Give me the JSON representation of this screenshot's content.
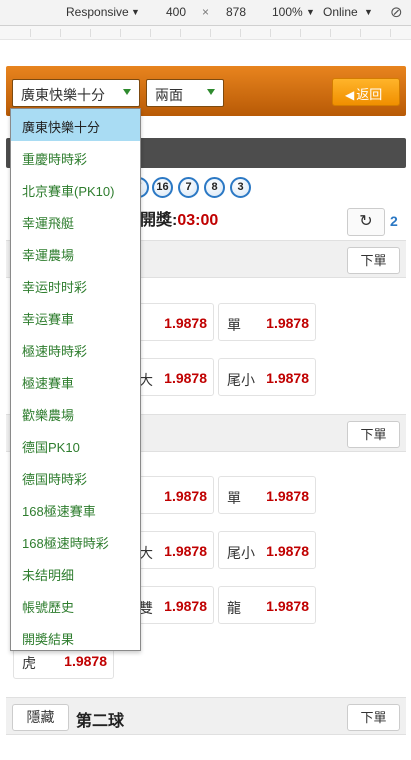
{
  "devtools": {
    "mode": "Responsive",
    "width": "400",
    "times": "×",
    "height": "878",
    "zoom": "100%",
    "network": "Online"
  },
  "header": {
    "lottery_select": "廣東快樂十分",
    "play_select": "兩面",
    "back_label": "返回",
    "back_icon": "arrow-left-icon"
  },
  "draw": {
    "balls": [
      "7",
      "16",
      "7",
      "8",
      "3"
    ],
    "label": "開獎:",
    "time": "03:00",
    "refresh_count": "2"
  },
  "sections": [
    {
      "order_label": "下單",
      "cells": [
        {
          "label": "",
          "odds": "1.9878"
        },
        {
          "label": "單",
          "odds": "1.9878"
        },
        {
          "label": "大",
          "odds": "1.9878"
        },
        {
          "label": "尾小",
          "odds": "1.9878"
        }
      ]
    },
    {
      "order_label": "下單",
      "cells": [
        {
          "label": "",
          "odds": "1.9878"
        },
        {
          "label": "單",
          "odds": "1.9878"
        },
        {
          "label": "大",
          "odds": "1.9878"
        },
        {
          "label": "尾小",
          "odds": "1.9878"
        },
        {
          "label": "雙",
          "odds": "1.9878"
        },
        {
          "label": "龍",
          "odds": "1.9878"
        },
        {
          "label": "虎",
          "odds": "1.9878"
        }
      ]
    },
    {
      "hide_label": "隱藏",
      "title": "第二球",
      "order_label": "下單"
    }
  ],
  "dropdown": {
    "items": [
      "廣東快樂十分",
      "重慶時時彩",
      "北京賽車(PK10)",
      "幸運飛艇",
      "幸運農場",
      "幸运时时彩",
      "幸运賽車",
      "極速時時彩",
      "極速賽車",
      "歡樂農場",
      "德国PK10",
      "德国時時彩",
      "168極速賽車",
      "168極速時時彩",
      "未结明细",
      "帳號歷史",
      "開奬結果"
    ],
    "selected_index": 0
  },
  "colors": {
    "header_orange": "#d46f12",
    "back_button": "#f8a414",
    "odds_red": "#c00000",
    "link_green": "#2e7d2e",
    "selected_blue": "#a9dcf3"
  }
}
